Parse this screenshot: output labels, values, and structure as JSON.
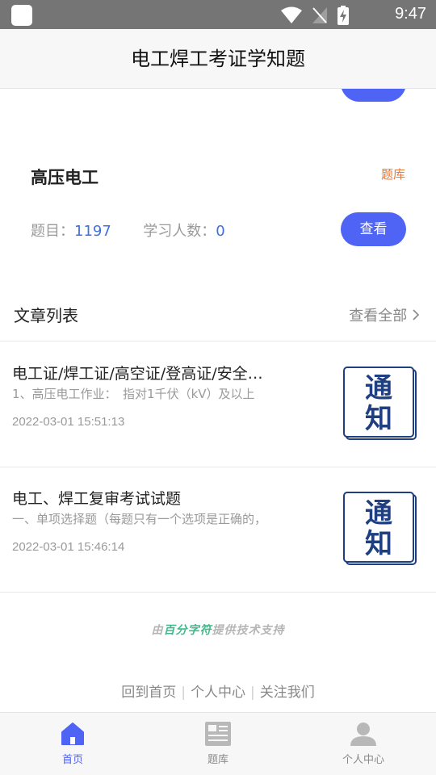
{
  "status_bar": {
    "time": "9:47"
  },
  "header": {
    "title": "电工焊工考证学知题"
  },
  "card": {
    "name": "高压电工",
    "tag": "题库",
    "questions_label": "题目：",
    "questions_count": "1197",
    "learners_label": "学习人数：",
    "learners_count": "0",
    "view_label": "查看"
  },
  "articles_section": {
    "title": "文章列表",
    "view_all": "查看全部"
  },
  "articles": [
    {
      "title": "电工证/焊工证/高空证/登高证/安全…",
      "summary": "1、高压电工作业：　指对1千伏（kV）及以上",
      "date": "2022-03-01 15:51:13",
      "thumb_text": [
        "通",
        "知"
      ]
    },
    {
      "title": "电工、焊工复审考试试题",
      "summary": "一、单项选择题（每题只有一个选项是正确的，",
      "date": "2022-03-01 15:46:14",
      "thumb_text": [
        "通",
        "知"
      ]
    }
  ],
  "powered": {
    "prefix": "由",
    "brand": "百分字符",
    "suffix": "提供技术支持"
  },
  "footer_links": [
    "回到首页",
    "个人中心",
    "关注我们"
  ],
  "tabs": [
    {
      "label": "首页",
      "icon": "home-icon",
      "active": true
    },
    {
      "label": "题库",
      "icon": "newspaper-icon",
      "active": false
    },
    {
      "label": "个人中心",
      "icon": "user-icon",
      "active": false
    }
  ],
  "colors": {
    "accent": "#4f63f5",
    "tag": "#e8773a",
    "number": "#3f6fe0",
    "brand": "#3fb98a"
  }
}
